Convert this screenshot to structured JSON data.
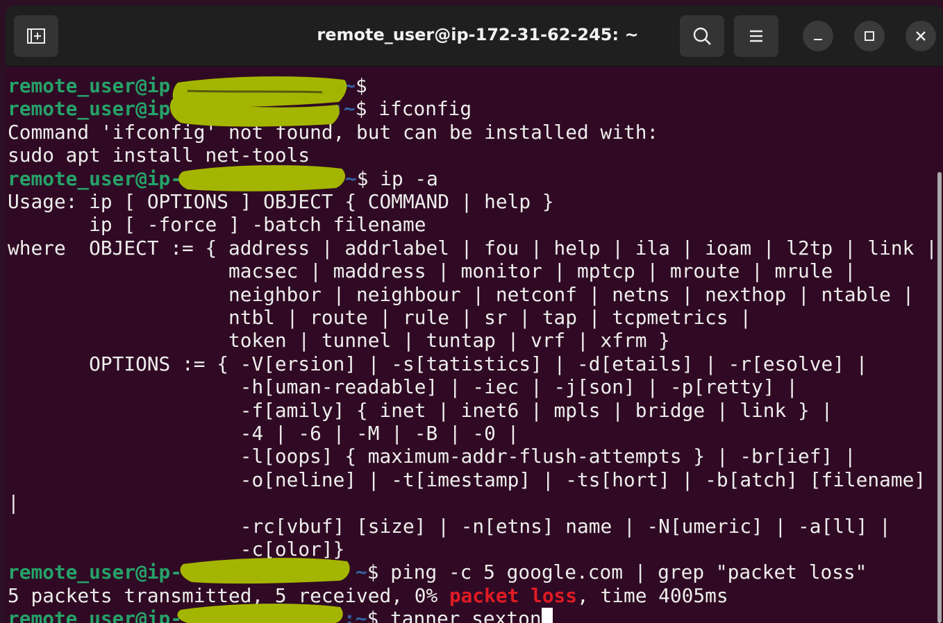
{
  "window": {
    "title": "remote_user@ip-172-31-62-245: ~",
    "buttons": {
      "new_tab": "new-tab-icon",
      "search": "search-icon",
      "menu": "hamburger-menu-icon",
      "minimize": "minimize-icon",
      "maximize": "maximize-icon",
      "close": "close-icon"
    }
  },
  "terminal": {
    "colors": {
      "background": "#300a24",
      "prompt_user": "#26a269",
      "prompt_path": "#3465a4",
      "text": "#eeeeec",
      "highlight": "#e01b24",
      "redaction": "#a4b500"
    },
    "prompt_user": "remote_user@ip",
    "prompt_user_dash": "remote_user@ip-",
    "prompt_user_partial": "remote_user@ip-172",
    "prompt_path_suffix": "~$",
    "prompt_colon_suffix": ":~$",
    "lines": {
      "l1_cmd": "",
      "l2_cmd": " ifconfig",
      "l3": "Command 'ifconfig' not found, but can be installed with:",
      "l4": "sudo apt install net-tools",
      "l5_cmd": " ip -a",
      "l6": "Usage: ip [ OPTIONS ] OBJECT { COMMAND | help }",
      "l7": "       ip [ -force ] -batch filename",
      "l8": "where  OBJECT := { address | addrlabel | fou | help | ila | ioam | l2tp | link |",
      "l9": "                   macsec | maddress | monitor | mptcp | mroute | mrule |",
      "l10": "                   neighbor | neighbour | netconf | netns | nexthop | ntable |",
      "l11": "                   ntbl | route | rule | sr | tap | tcpmetrics |",
      "l12": "                   token | tunnel | tuntap | vrf | xfrm }",
      "l13": "       OPTIONS := { -V[ersion] | -s[tatistics] | -d[etails] | -r[esolve] |",
      "l14": "                    -h[uman-readable] | -iec | -j[son] | -p[retty] |",
      "l15": "                    -f[amily] { inet | inet6 | mpls | bridge | link } |",
      "l16": "                    -4 | -6 | -M | -B | -0 |",
      "l17": "                    -l[oops] { maximum-addr-flush-attempts } | -br[ief] |",
      "l18": "                    -o[neline] | -t[imestamp] | -ts[hort] | -b[atch] [filename]",
      "l19": "|",
      "l20": "                    -rc[vbuf] [size] | -n[etns] name | -N[umeric] | -a[ll] |",
      "l21": "                    -c[olor]}",
      "l22_cmd": " ping -c 5 google.com | grep \"packet loss\"",
      "l23_a": "5 packets transmitted, 5 received, 0% ",
      "l23_hl": "packet loss",
      "l23_b": ", time 4005ms",
      "l24_cmd": " tanner sexton"
    }
  }
}
